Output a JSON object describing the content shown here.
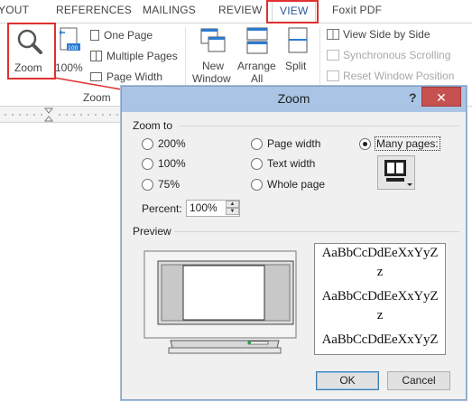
{
  "ribbon": {
    "tabs": [
      {
        "label": "YOUT",
        "active": false
      },
      {
        "label": "REFERENCES",
        "active": false
      },
      {
        "label": "MAILINGS",
        "active": false
      },
      {
        "label": "REVIEW",
        "active": false
      },
      {
        "label": "VIEW",
        "active": true
      },
      {
        "label": "Foxit PDF",
        "active": false
      }
    ],
    "zoom_group": {
      "zoom_label": "Zoom",
      "hundred_label": "100%",
      "one_page_label": "One Page",
      "multiple_pages_label": "Multiple Pages",
      "page_width_label": "Page Width",
      "group_label": "Zoom"
    },
    "window_group": {
      "new_window_label": "New Window",
      "new_label": "New",
      "window_label": "Window",
      "arrange_label": "Arrange",
      "all_label": "All",
      "split_label": "Split",
      "view_side_by_side_label": "View Side by Side",
      "sync_scrolling_label": "Synchronous Scrolling",
      "reset_window_label": "Reset Window Position"
    }
  },
  "dialog": {
    "title": "Zoom",
    "help": "?",
    "close": "✕",
    "zoom_to_label": "Zoom to",
    "options": {
      "p200": "200%",
      "p100": "100%",
      "p75": "75%",
      "page_width": "Page width",
      "text_width": "Text width",
      "whole_page": "Whole page",
      "many_pages": "Many pages:"
    },
    "selected_option": "many_pages",
    "percent_label": "Percent:",
    "percent_value": "100%",
    "preview_label": "Preview",
    "sample_lines": [
      "AaBbCcDdEeXxYyZ",
      "z",
      "AaBbCcDdEeXxYyZ",
      "z",
      "AaBbCcDdEeXxYyZ"
    ],
    "ok_label": "OK",
    "cancel_label": "Cancel"
  },
  "colors": {
    "highlight_red": "#e03030",
    "dialog_title_bg": "#a9c4e5",
    "close_red": "#c75050",
    "active_tab_text": "#2b579a"
  }
}
